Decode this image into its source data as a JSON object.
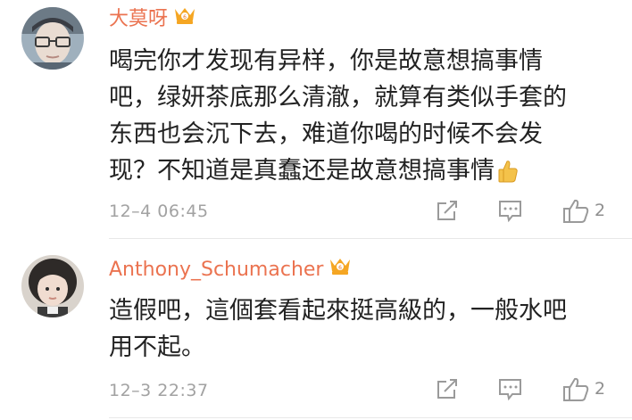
{
  "comments": [
    {
      "author": "大莫呀",
      "lines": [
        "喝完你才发现有异样，你是故意想搞事情",
        "吧，绿妍茶底那么清澈，就算有类似手套的",
        "东西也会沉下去，难道你喝的时候不会发",
        "现？不知道是真蠢还是故意想搞事情"
      ],
      "emoji": "thumbs-up-emoji",
      "time": "12–4 06:45",
      "likes": "2"
    },
    {
      "author": "Anthony_Schumacher",
      "lines": [
        "造假吧，這個套看起來挺高級的，一般水吧",
        "用不起。"
      ],
      "time": "12–3 22:37",
      "likes": "2"
    }
  ],
  "icons": {
    "vip_badge": "crown-badge-icon",
    "forward": "forward-icon",
    "comment": "comment-icon",
    "like": "like-icon"
  },
  "colors": {
    "author": "#eb7350",
    "badge": "#f5a623",
    "text": "#222222",
    "meta": "#a2a2a2",
    "icon": "#9a9a9a"
  }
}
